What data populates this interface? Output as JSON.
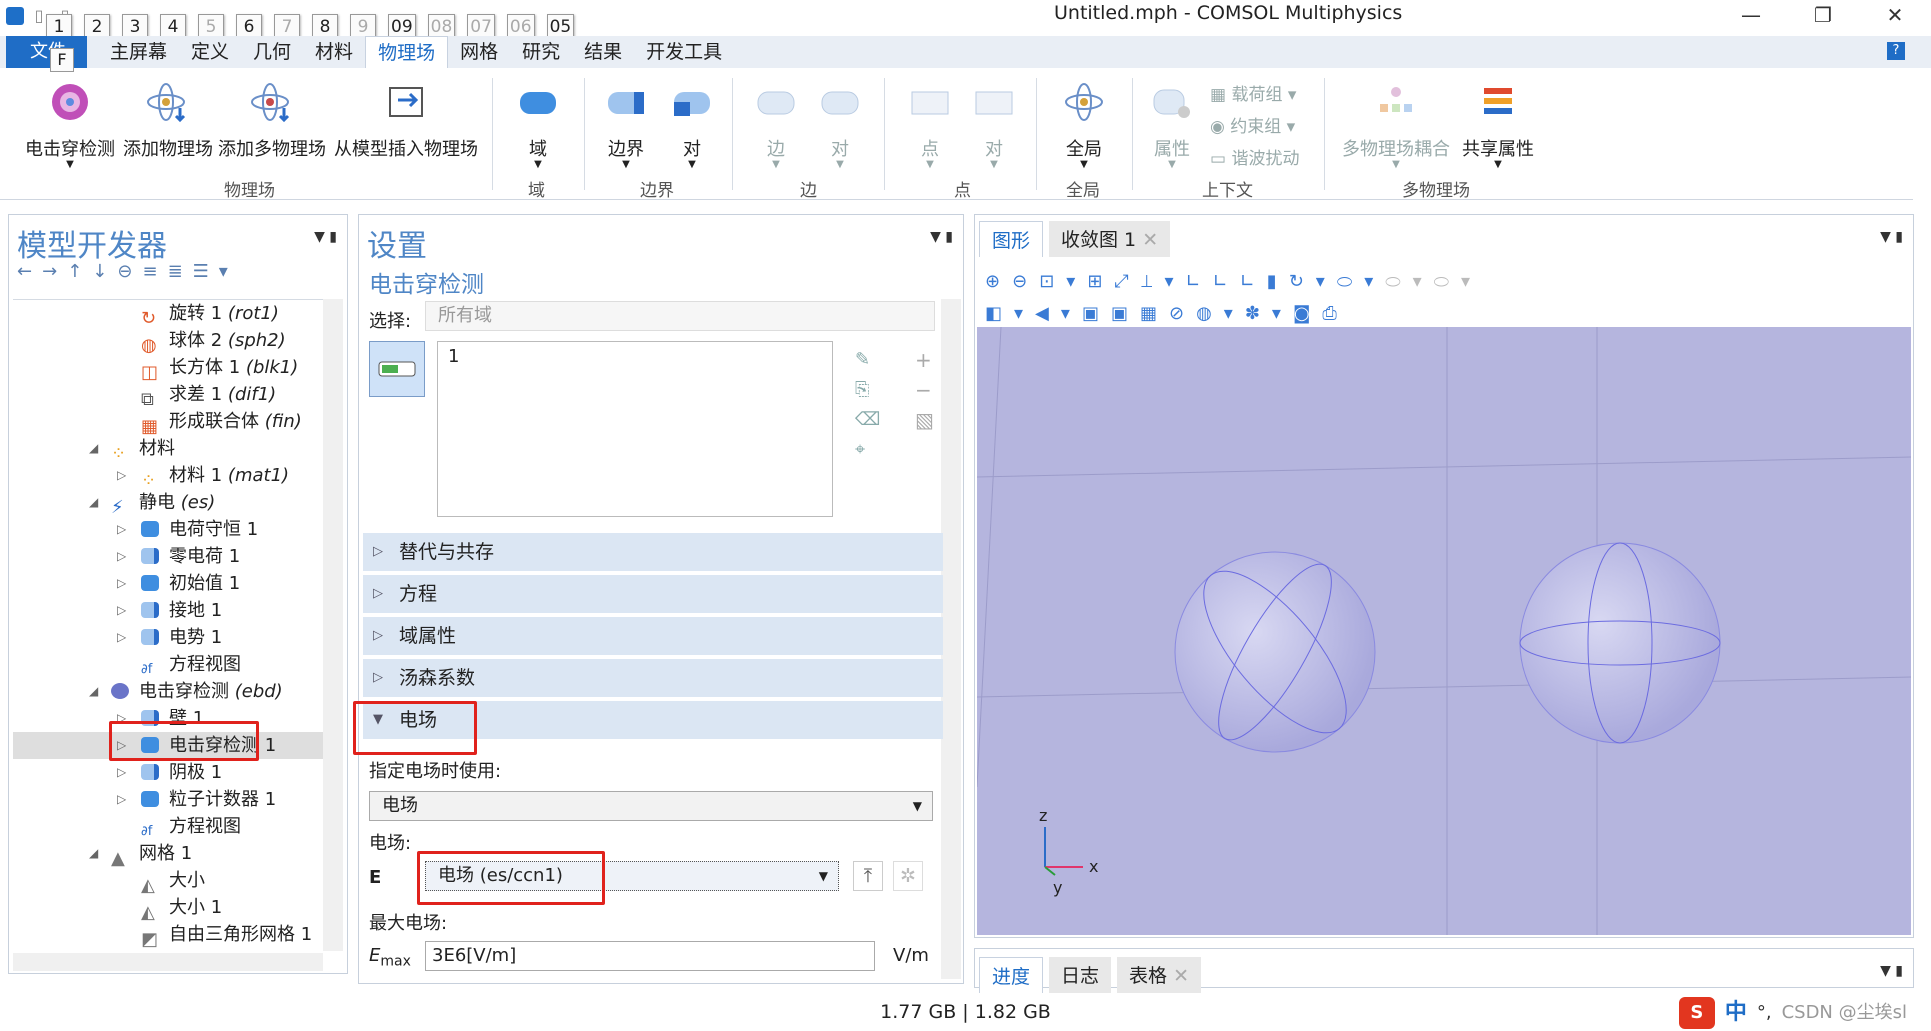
{
  "window": {
    "title": "Untitled.mph - COMSOL Multiphysics"
  },
  "keytips": [
    "1",
    "2",
    "3",
    "4",
    "5",
    "6",
    "7",
    "8",
    "9",
    "09",
    "08",
    "07",
    "06",
    "05"
  ],
  "file_tab": {
    "label": "文件",
    "keytip": "F"
  },
  "menu_tabs": [
    "主屏幕",
    "定义",
    "几何",
    "材料",
    "物理场",
    "网格",
    "研究",
    "结果",
    "开发工具"
  ],
  "ribbon": {
    "physics": {
      "b1": "电击穿检测",
      "b2": "添加物理场",
      "b3": "添加多物理场",
      "b4": "从模型插入物理场",
      "group": "物理场"
    },
    "domain": {
      "b1": "域",
      "group": "域"
    },
    "boundary": {
      "b1": "边界",
      "b2": "对",
      "group": "边界"
    },
    "edge": {
      "b1": "边",
      "b2": "对",
      "group": "边"
    },
    "point": {
      "b1": "点",
      "b2": "对",
      "group": "点"
    },
    "global": {
      "b1": "全局",
      "group": "全局"
    },
    "context": {
      "b1": "属性",
      "s1": "载荷组",
      "s2": "约束组",
      "s3": "谐波扰动",
      "group": "上下文"
    },
    "multiphysics": {
      "b1": "多物理场耦合",
      "b2": "共享属性",
      "group": "多物理场"
    }
  },
  "model_builder": {
    "title": "模型开发器",
    "tree": [
      {
        "label": "旋转 1",
        "tag": "(rot1)"
      },
      {
        "label": "球体 2",
        "tag": "(sph2)"
      },
      {
        "label": "长方体 1",
        "tag": "(blk1)"
      },
      {
        "label": "求差 1",
        "tag": "(dif1)"
      },
      {
        "label": "形成联合体",
        "tag": "(fin)"
      },
      {
        "label": "材料",
        "tag": ""
      },
      {
        "label": "材料 1",
        "tag": "(mat1)"
      },
      {
        "label": "静电",
        "tag": "(es)"
      },
      {
        "label": "电荷守恒 1",
        "tag": ""
      },
      {
        "label": "零电荷 1",
        "tag": ""
      },
      {
        "label": "初始值 1",
        "tag": ""
      },
      {
        "label": "接地 1",
        "tag": ""
      },
      {
        "label": "电势 1",
        "tag": ""
      },
      {
        "label": "方程视图",
        "tag": ""
      },
      {
        "label": "电击穿检测",
        "tag": "(ebd)"
      },
      {
        "label": "壁 1",
        "tag": ""
      },
      {
        "label": "电击穿检测 1",
        "tag": ""
      },
      {
        "label": "阴极 1",
        "tag": ""
      },
      {
        "label": "粒子计数器 1",
        "tag": ""
      },
      {
        "label": "方程视图",
        "tag": ""
      },
      {
        "label": "网格 1",
        "tag": ""
      },
      {
        "label": "大小",
        "tag": ""
      },
      {
        "label": "大小 1",
        "tag": ""
      },
      {
        "label": "自由三角形网格 1",
        "tag": ""
      }
    ]
  },
  "settings": {
    "title": "设置",
    "subtitle": "电击穿检测",
    "selection_label": "选择:",
    "selection_value": "所有域",
    "list_item": "1",
    "sections": [
      "替代与共存",
      "方程",
      "域属性",
      "汤森系数",
      "电场"
    ],
    "field_use_label": "指定电场时使用:",
    "field_use_value": "电场",
    "field_label": "电场:",
    "E_symbol": "E",
    "E_value": "电场 (es/ccn1)",
    "max_label": "最大电场:",
    "Emax_symbol": "E",
    "Emax_sub": "max",
    "Emax_value": "3E6[V/m]",
    "Emax_unit": "V/m"
  },
  "graphics": {
    "tabs": [
      "图形",
      "收敛图 1"
    ],
    "axes": {
      "z": "z",
      "x": "x",
      "y": "y"
    }
  },
  "bottom_tabs": [
    "进度",
    "日志",
    "表格"
  ],
  "status": {
    "memory": "1.77 GB | 1.82 GB"
  },
  "ime": {
    "lang": "中",
    "watermark": "CSDN @尘埃sl"
  }
}
